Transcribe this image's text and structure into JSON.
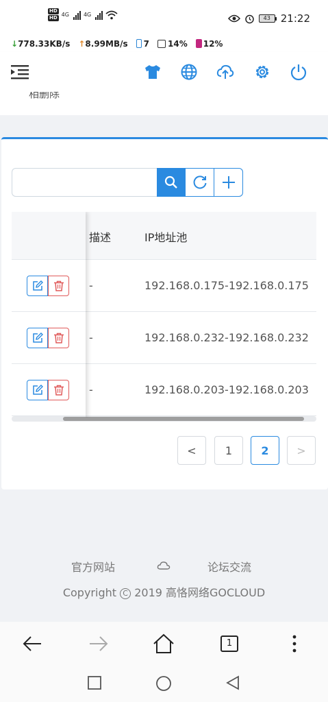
{
  "status_bar": {
    "network": "4G",
    "battery_level": "43",
    "time": "21:22"
  },
  "speed_bar": {
    "download": "778.33KB/s",
    "upload": "8.99MB/s",
    "app_count": "7",
    "cpu": "14%",
    "battery": "12%"
  },
  "header": {
    "icons": [
      "menu-toggle-icon",
      "theme-shirt-icon",
      "globe-icon",
      "cloud-upload-icon",
      "gear-icon",
      "power-icon"
    ],
    "accent_color": "#2a8ae0"
  },
  "top_card": {
    "partial_text": "相删除"
  },
  "toolbar": {
    "search_value": "",
    "search_placeholder": ""
  },
  "table": {
    "columns": [
      "",
      "描述",
      "IP地址池"
    ],
    "rows": [
      {
        "description": "-",
        "ip_pool": "192.168.0.175-192.168.0.175"
      },
      {
        "description": "-",
        "ip_pool": "192.168.0.232-192.168.0.232"
      },
      {
        "description": "-",
        "ip_pool": "192.168.0.203-192.168.0.203"
      }
    ]
  },
  "pagination": {
    "prev": "<",
    "pages": [
      "1",
      "2"
    ],
    "current": "2",
    "next": ">"
  },
  "footer": {
    "link_official": "官方网站",
    "link_forum": "论坛交流",
    "copyright_prefix": "Copyright",
    "copyright_symbol": "C",
    "copyright_rest": "2019 高恪网络GOCLOUD"
  },
  "browser": {
    "tab_count": "1"
  }
}
